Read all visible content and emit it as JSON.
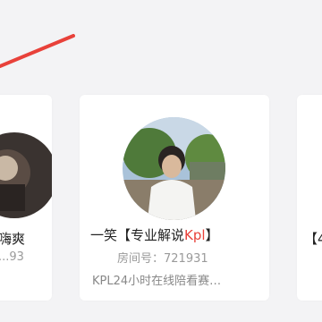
{
  "colors": {
    "accent": "#e8413a",
    "background": "#f3f3f5",
    "card": "#ffffff"
  },
  "cards": [
    {
      "name_part1": "",
      "name_highlight": "",
      "name_part2": "嗨爽",
      "room": "...93",
      "desc": ""
    },
    {
      "name_part1": "一笑【专业解说",
      "name_highlight": "Kpl",
      "name_part2": "】",
      "room": "房间号：721931",
      "desc": "KPL24小时在线陪看赛…"
    },
    {
      "name_part1": "【4",
      "name_highlight": "",
      "name_part2": "",
      "room": "",
      "desc": ""
    }
  ]
}
